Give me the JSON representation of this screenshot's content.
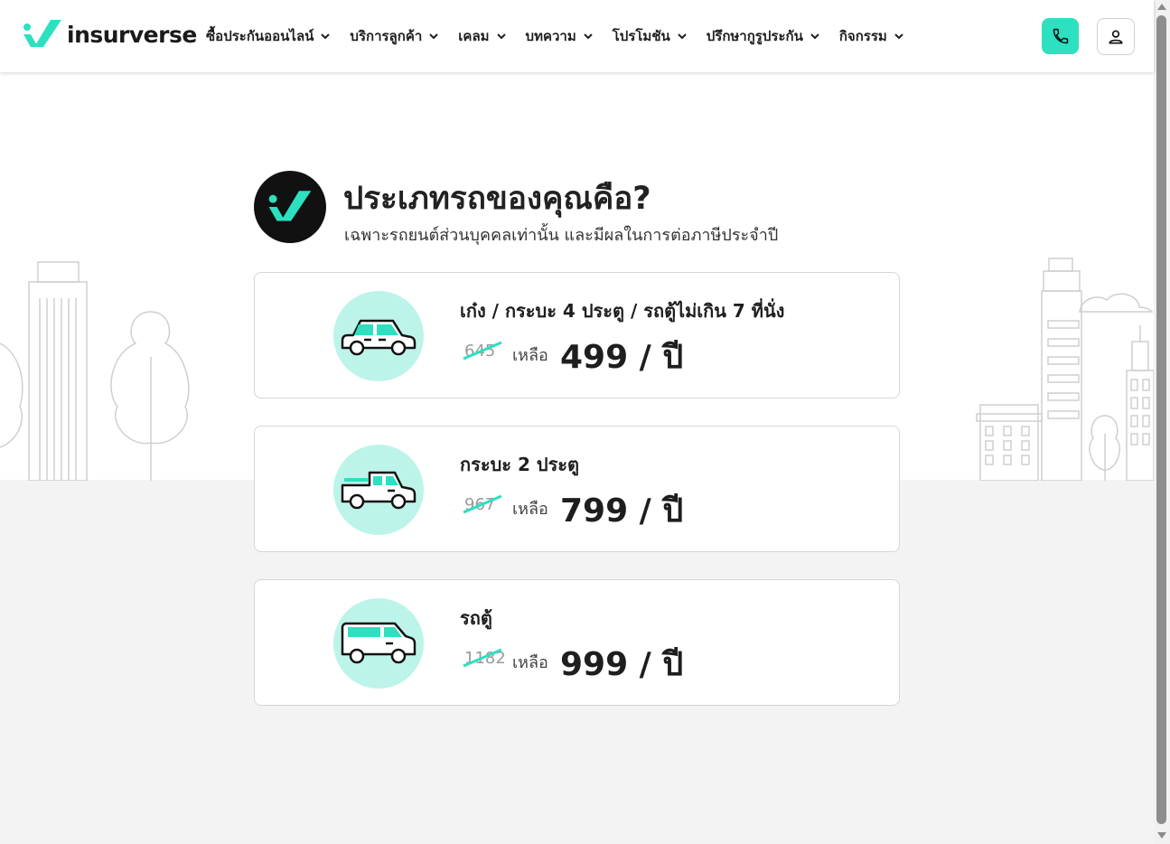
{
  "brand": {
    "name": "insurverse",
    "accent": "#2de0c0",
    "light_accent": "#bdf4ea"
  },
  "nav": {
    "items": [
      {
        "label": "ซื้อประกันออนไลน์"
      },
      {
        "label": "บริการลูกค้า"
      },
      {
        "label": "เคลม"
      },
      {
        "label": "บทความ"
      },
      {
        "label": "โปรโมชัน"
      },
      {
        "label": "ปรึกษากูรูประกัน"
      },
      {
        "label": "กิจกรรม"
      }
    ],
    "phone_icon": "phone-icon",
    "user_icon": "user-icon"
  },
  "question": {
    "title": "ประเภทรถของคุณคือ?",
    "subtitle": "เฉพาะรถยนต์ส่วนบุคคลเท่านั้น และมีผลในการต่อภาษีประจำปี"
  },
  "options": [
    {
      "label": "เก๋ง / กระบะ 4 ประตู / รถตู้ไม่เกิน 7 ที่นั่ง",
      "old_price": "645",
      "remain_label": "เหลือ",
      "price": "499 / ปี",
      "icon": "sedan-icon"
    },
    {
      "label": "กระบะ 2 ประตู",
      "old_price": "967",
      "remain_label": "เหลือ",
      "price": "799 / ปี",
      "icon": "pickup-icon"
    },
    {
      "label": "รถตู้",
      "old_price": "1182",
      "remain_label": "เหลือ",
      "price": "999 / ปี",
      "icon": "van-icon"
    }
  ]
}
